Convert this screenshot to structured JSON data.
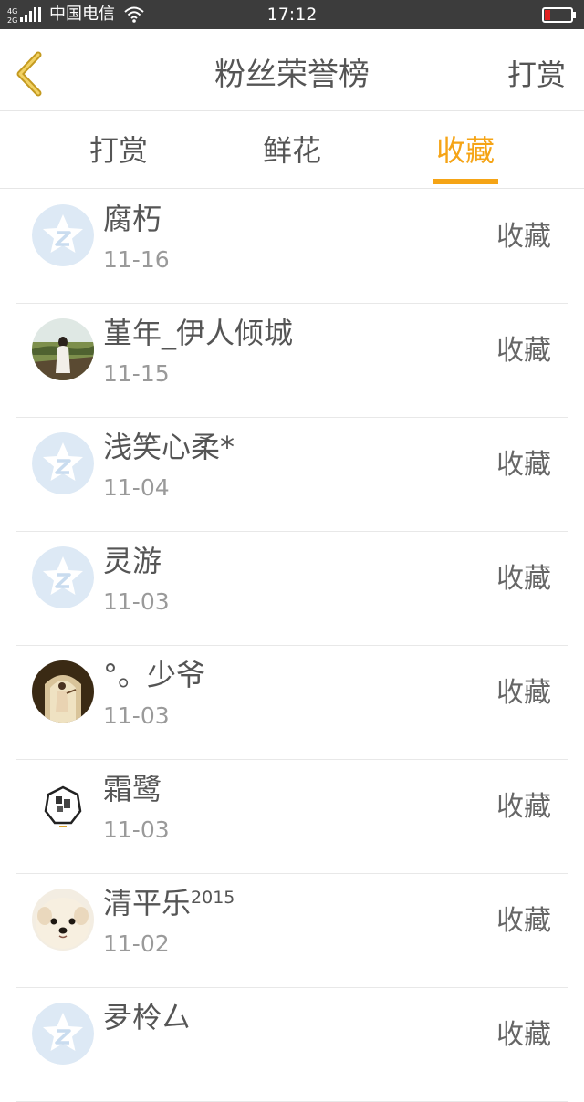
{
  "status_bar": {
    "network": "4G 2G",
    "carrier": "中国电信",
    "time": "17:12"
  },
  "navbar": {
    "title": "粉丝荣誉榜",
    "action_label": "打赏"
  },
  "tabs": [
    {
      "label": "打赏",
      "active": false
    },
    {
      "label": "鲜花",
      "active": false
    },
    {
      "label": "收藏",
      "active": true
    }
  ],
  "colors": {
    "accent": "#f5a416",
    "text": "#555555",
    "subtext": "#9a9a9a",
    "battery_low": "#e02020"
  },
  "list": [
    {
      "name": "腐朽",
      "sup": "",
      "date": "11-16",
      "action": "收藏",
      "avatar": "default-star-icon"
    },
    {
      "name": "堇年_伊人倾城",
      "sup": "",
      "date": "11-15",
      "action": "收藏",
      "avatar": "photo-field"
    },
    {
      "name": "浅笑心柔*",
      "sup": "",
      "date": "11-04",
      "action": "收藏",
      "avatar": "default-star-icon"
    },
    {
      "name": "灵游",
      "sup": "",
      "date": "11-03",
      "action": "收藏",
      "avatar": "default-star-icon"
    },
    {
      "name": "°。少爷",
      "sup": "",
      "date": "11-03",
      "action": "收藏",
      "avatar": "photo-doorway"
    },
    {
      "name": "霜鹭",
      "sup": "",
      "date": "11-03",
      "action": "收藏",
      "avatar": "seal-logo"
    },
    {
      "name": "清平乐",
      "sup": "2015",
      "date": "11-02",
      "action": "收藏",
      "avatar": "photo-puppy"
    },
    {
      "name": "夛柃厶",
      "sup": "",
      "date": "",
      "action": "收藏",
      "avatar": "default-star-icon"
    }
  ]
}
